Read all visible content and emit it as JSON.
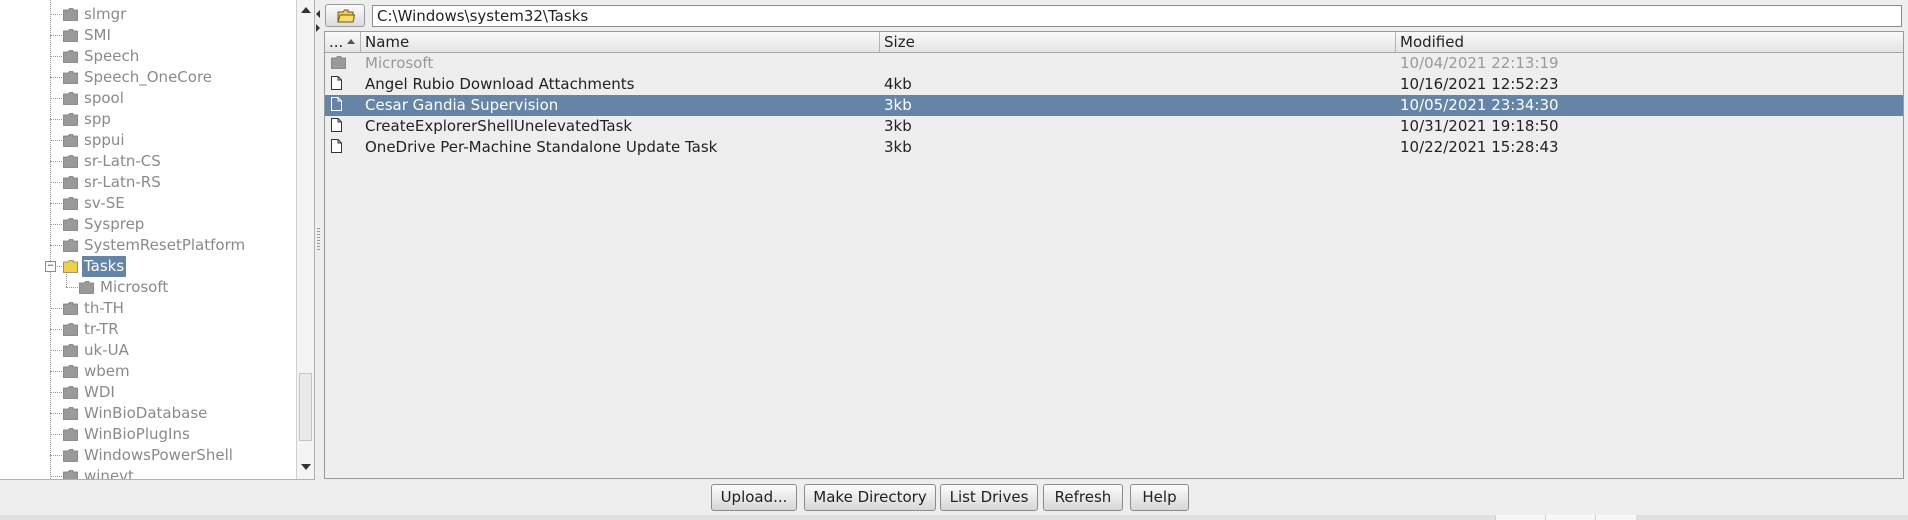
{
  "tree": {
    "items": [
      {
        "label": "slmgr"
      },
      {
        "label": "SMI"
      },
      {
        "label": "Speech"
      },
      {
        "label": "Speech_OneCore"
      },
      {
        "label": "spool"
      },
      {
        "label": "spp"
      },
      {
        "label": "sppui"
      },
      {
        "label": "sr-Latn-CS"
      },
      {
        "label": "sr-Latn-RS"
      },
      {
        "label": "sv-SE"
      },
      {
        "label": "Sysprep"
      },
      {
        "label": "SystemResetPlatform"
      },
      {
        "label": "Tasks",
        "selected": true,
        "expanded": true
      },
      {
        "label": "Microsoft",
        "child": true
      },
      {
        "label": "th-TH"
      },
      {
        "label": "tr-TR"
      },
      {
        "label": "uk-UA"
      },
      {
        "label": "wbem"
      },
      {
        "label": "WDI"
      },
      {
        "label": "WinBioDatabase"
      },
      {
        "label": "WinBioPlugIns"
      },
      {
        "label": "WindowsPowerShell"
      },
      {
        "label": "winevt"
      }
    ]
  },
  "path_bar": {
    "path": "C:\\Windows\\system32\\Tasks"
  },
  "table": {
    "columns": {
      "icon": "...",
      "name": "Name",
      "size": "Size",
      "modified": "Modified"
    },
    "rows": [
      {
        "type": "dir",
        "name": "Microsoft",
        "size": "",
        "modified": "10/04/2021 22:13:19"
      },
      {
        "type": "file",
        "name": "Angel Rubio Download Attachments",
        "size": "4kb",
        "modified": "10/16/2021 12:52:23"
      },
      {
        "type": "file",
        "name": "Cesar Gandia Supervision",
        "size": "3kb",
        "modified": "10/05/2021 23:34:30",
        "selected": true
      },
      {
        "type": "file",
        "name": "CreateExplorerShellUnelevatedTask",
        "size": "3kb",
        "modified": "10/31/2021 19:18:50"
      },
      {
        "type": "file",
        "name": "OneDrive Per-Machine Standalone Update Task",
        "size": "3kb",
        "modified": "10/22/2021 15:28:43"
      }
    ]
  },
  "buttons": {
    "upload": "Upload...",
    "make_directory": "Make Directory",
    "list_drives": "List Drives",
    "refresh": "Refresh",
    "help": "Help"
  },
  "colors": {
    "selection": "#6584a6",
    "folder_gray": "#9a9a9a",
    "folder_yellow": "#f2cf4a"
  },
  "icons": {
    "folder": "folder-icon",
    "document": "document-icon",
    "open_folder": "open-folder-icon"
  }
}
